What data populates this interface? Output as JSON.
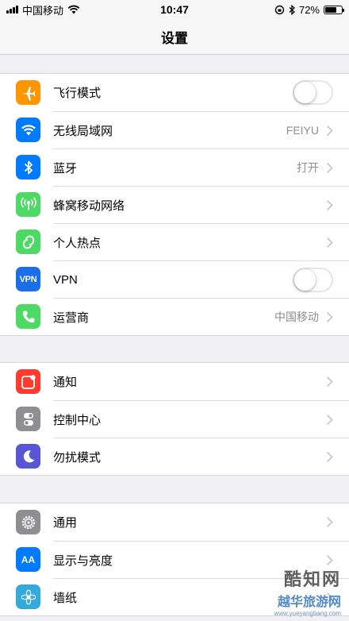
{
  "status_bar": {
    "carrier": "中国移动",
    "time": "10:47",
    "battery_percent_text": "72%",
    "battery_level": 0.72
  },
  "nav": {
    "title": "设置"
  },
  "sections": [
    [
      {
        "label": "飞行模式",
        "icon": "airplane-icon",
        "color": "#ff9500",
        "control": "toggle",
        "on": false
      },
      {
        "label": "无线局域网",
        "icon": "wifi-icon",
        "color": "#007aff",
        "value": "FEIYU",
        "control": "chevron"
      },
      {
        "label": "蓝牙",
        "icon": "bluetooth-icon",
        "color": "#007aff",
        "value": "打开",
        "control": "chevron"
      },
      {
        "label": "蜂窝移动网络",
        "icon": "cellular-icon",
        "color": "#4cd964",
        "control": "chevron"
      },
      {
        "label": "个人热点",
        "icon": "hotspot-icon",
        "color": "#4cd964",
        "control": "chevron"
      },
      {
        "label": "VPN",
        "icon": "vpn-icon",
        "color": "#1a6ee8",
        "control": "toggle",
        "on": false
      },
      {
        "label": "运营商",
        "icon": "phone-icon",
        "color": "#4cd964",
        "value": "中国移动",
        "control": "chevron"
      }
    ],
    [
      {
        "label": "通知",
        "icon": "notifications-icon",
        "color": "#ff3b30",
        "control": "chevron"
      },
      {
        "label": "控制中心",
        "icon": "control-center-icon",
        "color": "#8e8e93",
        "control": "chevron"
      },
      {
        "label": "勿扰模式",
        "icon": "moon-icon",
        "color": "#5856d6",
        "control": "chevron"
      }
    ],
    [
      {
        "label": "通用",
        "icon": "gear-icon",
        "color": "#8e8e93",
        "control": "chevron"
      },
      {
        "label": "显示与亮度",
        "icon": "display-brightness-icon",
        "color": "#007aff",
        "control": "chevron"
      },
      {
        "label": "墙纸",
        "icon": "wallpaper-icon",
        "color": "#34aadc",
        "control": "chevron"
      }
    ]
  ],
  "watermark": {
    "line1": "酷知网",
    "line2": "越华旅游网",
    "line3": "www.yueyangbang.com"
  }
}
